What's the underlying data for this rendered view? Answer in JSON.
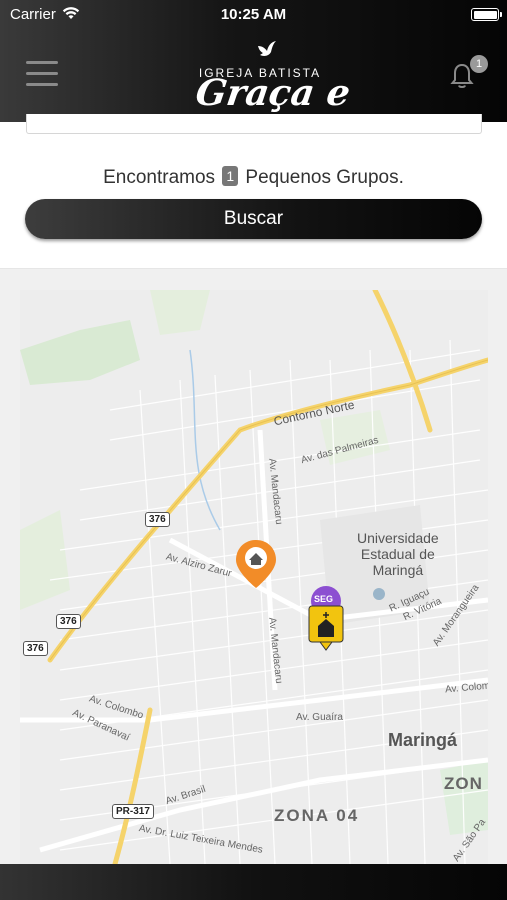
{
  "status_bar": {
    "carrier": "Carrier",
    "time": "10:25 AM"
  },
  "header": {
    "logo_subtitle": "IGREJA BATISTA",
    "logo_title": "Graça e Paz",
    "notification_count": "1"
  },
  "results": {
    "prefix": "Encontramos",
    "count": "1",
    "suffix": "Pequenos Grupos."
  },
  "search_button": "Buscar",
  "map": {
    "labels": {
      "contorno_norte": "Contorno Norte",
      "av_palmeiras": "Av. das Palmeiras",
      "av_mandacaru_1": "Av. Mandacaru",
      "av_mandacaru_2": "Av. Mandacaru",
      "universidade": "Universidade\nEstadual de\nMaringá",
      "av_alziro": "Av. Alziro Zarur",
      "r_iguacu": "R. Iguaçu",
      "r_vitoria": "R. Vitória",
      "av_morangueira": "Av. Morangueira",
      "av_colombo": "Av. Colombo",
      "av_paranavai": "Av. Paranavaí",
      "av_guaira": "Av. Guaíra",
      "av_colombo_2": "Av. Colombo",
      "maringa": "Maringá",
      "zona": "ZON",
      "av_brasil": "Av. Brasil",
      "zona04": "ZONA 04",
      "av_luiz": "Av. Dr. Luiz Teixeira Mendes",
      "av_sao_pa": "Av. São Pa",
      "shield_376_1": "376",
      "shield_376_2": "376",
      "shield_376_3": "376",
      "shield_pr317": "PR-317"
    },
    "marker_home": "home-marker",
    "marker_church": "church-marker",
    "church_tag": "SEG"
  },
  "colors": {
    "header_dark": "#0a0a0a",
    "marker_orange": "#f28c28",
    "marker_purple": "#8c4fd1",
    "marker_yellow": "#f2c40f",
    "road_yellow": "#f5d36b"
  }
}
